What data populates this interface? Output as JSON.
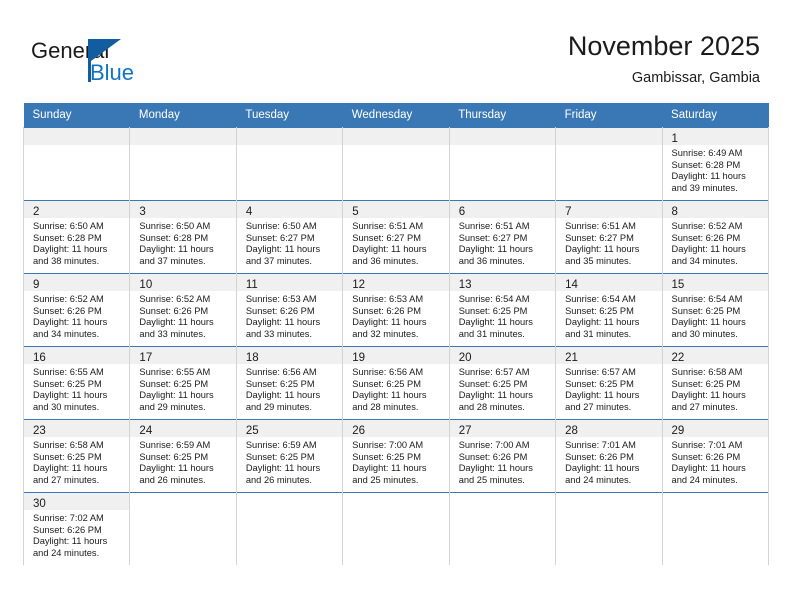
{
  "logo": {
    "word1": "General",
    "word2": "Blue",
    "triangle_color": "#125ca0",
    "blue_text_color": "#1273c4"
  },
  "header": {
    "title": "November 2025",
    "location": "Gambissar, Gambia"
  },
  "theme": {
    "header_blue": "#3a78b5",
    "row_separator": "#3a78b5",
    "daynum_band": "#f0f0f0",
    "cell_border": "#d4d4d4"
  },
  "weekdays": [
    "Sunday",
    "Monday",
    "Tuesday",
    "Wednesday",
    "Thursday",
    "Friday",
    "Saturday"
  ],
  "labels": {
    "sunrise_prefix": "Sunrise: ",
    "sunset_prefix": "Sunset: ",
    "daylight_prefix": "Daylight: "
  },
  "weeks": [
    [
      {
        "empty": true
      },
      {
        "empty": true
      },
      {
        "empty": true
      },
      {
        "empty": true
      },
      {
        "empty": true
      },
      {
        "empty": true
      },
      {
        "day": "1",
        "sunrise": "Sunrise: 6:49 AM",
        "sunset": "Sunset: 6:28 PM",
        "daylight1": "Daylight: 11 hours",
        "daylight2": "and 39 minutes."
      }
    ],
    [
      {
        "day": "2",
        "sunrise": "Sunrise: 6:50 AM",
        "sunset": "Sunset: 6:28 PM",
        "daylight1": "Daylight: 11 hours",
        "daylight2": "and 38 minutes."
      },
      {
        "day": "3",
        "sunrise": "Sunrise: 6:50 AM",
        "sunset": "Sunset: 6:28 PM",
        "daylight1": "Daylight: 11 hours",
        "daylight2": "and 37 minutes."
      },
      {
        "day": "4",
        "sunrise": "Sunrise: 6:50 AM",
        "sunset": "Sunset: 6:27 PM",
        "daylight1": "Daylight: 11 hours",
        "daylight2": "and 37 minutes."
      },
      {
        "day": "5",
        "sunrise": "Sunrise: 6:51 AM",
        "sunset": "Sunset: 6:27 PM",
        "daylight1": "Daylight: 11 hours",
        "daylight2": "and 36 minutes."
      },
      {
        "day": "6",
        "sunrise": "Sunrise: 6:51 AM",
        "sunset": "Sunset: 6:27 PM",
        "daylight1": "Daylight: 11 hours",
        "daylight2": "and 36 minutes."
      },
      {
        "day": "7",
        "sunrise": "Sunrise: 6:51 AM",
        "sunset": "Sunset: 6:27 PM",
        "daylight1": "Daylight: 11 hours",
        "daylight2": "and 35 minutes."
      },
      {
        "day": "8",
        "sunrise": "Sunrise: 6:52 AM",
        "sunset": "Sunset: 6:26 PM",
        "daylight1": "Daylight: 11 hours",
        "daylight2": "and 34 minutes."
      }
    ],
    [
      {
        "day": "9",
        "sunrise": "Sunrise: 6:52 AM",
        "sunset": "Sunset: 6:26 PM",
        "daylight1": "Daylight: 11 hours",
        "daylight2": "and 34 minutes."
      },
      {
        "day": "10",
        "sunrise": "Sunrise: 6:52 AM",
        "sunset": "Sunset: 6:26 PM",
        "daylight1": "Daylight: 11 hours",
        "daylight2": "and 33 minutes."
      },
      {
        "day": "11",
        "sunrise": "Sunrise: 6:53 AM",
        "sunset": "Sunset: 6:26 PM",
        "daylight1": "Daylight: 11 hours",
        "daylight2": "and 33 minutes."
      },
      {
        "day": "12",
        "sunrise": "Sunrise: 6:53 AM",
        "sunset": "Sunset: 6:26 PM",
        "daylight1": "Daylight: 11 hours",
        "daylight2": "and 32 minutes."
      },
      {
        "day": "13",
        "sunrise": "Sunrise: 6:54 AM",
        "sunset": "Sunset: 6:25 PM",
        "daylight1": "Daylight: 11 hours",
        "daylight2": "and 31 minutes."
      },
      {
        "day": "14",
        "sunrise": "Sunrise: 6:54 AM",
        "sunset": "Sunset: 6:25 PM",
        "daylight1": "Daylight: 11 hours",
        "daylight2": "and 31 minutes."
      },
      {
        "day": "15",
        "sunrise": "Sunrise: 6:54 AM",
        "sunset": "Sunset: 6:25 PM",
        "daylight1": "Daylight: 11 hours",
        "daylight2": "and 30 minutes."
      }
    ],
    [
      {
        "day": "16",
        "sunrise": "Sunrise: 6:55 AM",
        "sunset": "Sunset: 6:25 PM",
        "daylight1": "Daylight: 11 hours",
        "daylight2": "and 30 minutes."
      },
      {
        "day": "17",
        "sunrise": "Sunrise: 6:55 AM",
        "sunset": "Sunset: 6:25 PM",
        "daylight1": "Daylight: 11 hours",
        "daylight2": "and 29 minutes."
      },
      {
        "day": "18",
        "sunrise": "Sunrise: 6:56 AM",
        "sunset": "Sunset: 6:25 PM",
        "daylight1": "Daylight: 11 hours",
        "daylight2": "and 29 minutes."
      },
      {
        "day": "19",
        "sunrise": "Sunrise: 6:56 AM",
        "sunset": "Sunset: 6:25 PM",
        "daylight1": "Daylight: 11 hours",
        "daylight2": "and 28 minutes."
      },
      {
        "day": "20",
        "sunrise": "Sunrise: 6:57 AM",
        "sunset": "Sunset: 6:25 PM",
        "daylight1": "Daylight: 11 hours",
        "daylight2": "and 28 minutes."
      },
      {
        "day": "21",
        "sunrise": "Sunrise: 6:57 AM",
        "sunset": "Sunset: 6:25 PM",
        "daylight1": "Daylight: 11 hours",
        "daylight2": "and 27 minutes."
      },
      {
        "day": "22",
        "sunrise": "Sunrise: 6:58 AM",
        "sunset": "Sunset: 6:25 PM",
        "daylight1": "Daylight: 11 hours",
        "daylight2": "and 27 minutes."
      }
    ],
    [
      {
        "day": "23",
        "sunrise": "Sunrise: 6:58 AM",
        "sunset": "Sunset: 6:25 PM",
        "daylight1": "Daylight: 11 hours",
        "daylight2": "and 27 minutes."
      },
      {
        "day": "24",
        "sunrise": "Sunrise: 6:59 AM",
        "sunset": "Sunset: 6:25 PM",
        "daylight1": "Daylight: 11 hours",
        "daylight2": "and 26 minutes."
      },
      {
        "day": "25",
        "sunrise": "Sunrise: 6:59 AM",
        "sunset": "Sunset: 6:25 PM",
        "daylight1": "Daylight: 11 hours",
        "daylight2": "and 26 minutes."
      },
      {
        "day": "26",
        "sunrise": "Sunrise: 7:00 AM",
        "sunset": "Sunset: 6:25 PM",
        "daylight1": "Daylight: 11 hours",
        "daylight2": "and 25 minutes."
      },
      {
        "day": "27",
        "sunrise": "Sunrise: 7:00 AM",
        "sunset": "Sunset: 6:26 PM",
        "daylight1": "Daylight: 11 hours",
        "daylight2": "and 25 minutes."
      },
      {
        "day": "28",
        "sunrise": "Sunrise: 7:01 AM",
        "sunset": "Sunset: 6:26 PM",
        "daylight1": "Daylight: 11 hours",
        "daylight2": "and 24 minutes."
      },
      {
        "day": "29",
        "sunrise": "Sunrise: 7:01 AM",
        "sunset": "Sunset: 6:26 PM",
        "daylight1": "Daylight: 11 hours",
        "daylight2": "and 24 minutes."
      }
    ],
    [
      {
        "day": "30",
        "sunrise": "Sunrise: 7:02 AM",
        "sunset": "Sunset: 6:26 PM",
        "daylight1": "Daylight: 11 hours",
        "daylight2": "and 24 minutes."
      },
      {
        "blank": true
      },
      {
        "blank": true
      },
      {
        "blank": true
      },
      {
        "blank": true
      },
      {
        "blank": true
      },
      {
        "blank": true
      }
    ]
  ]
}
